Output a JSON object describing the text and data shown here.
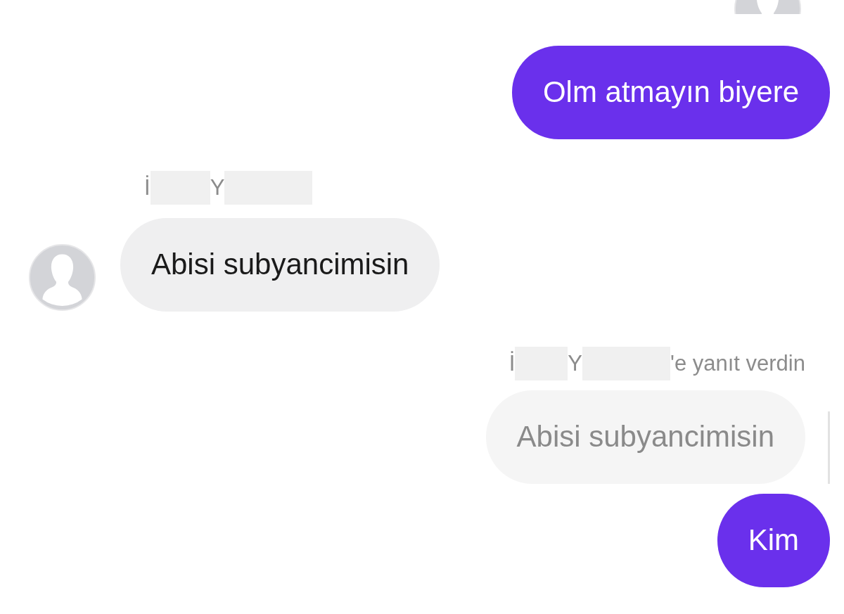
{
  "messages": [
    {
      "kind": "outgoing",
      "text": "Olm atmayın biyere"
    },
    {
      "kind": "incoming",
      "sender": [
        "İ",
        "Y"
      ],
      "text": "Abisi subyancimisin"
    },
    {
      "kind": "outgoing",
      "reply_label": [
        "İ",
        "Y",
        "'e yanıt verdin"
      ],
      "quoted": "Abisi subyancimisin",
      "text": "Kim"
    }
  ]
}
